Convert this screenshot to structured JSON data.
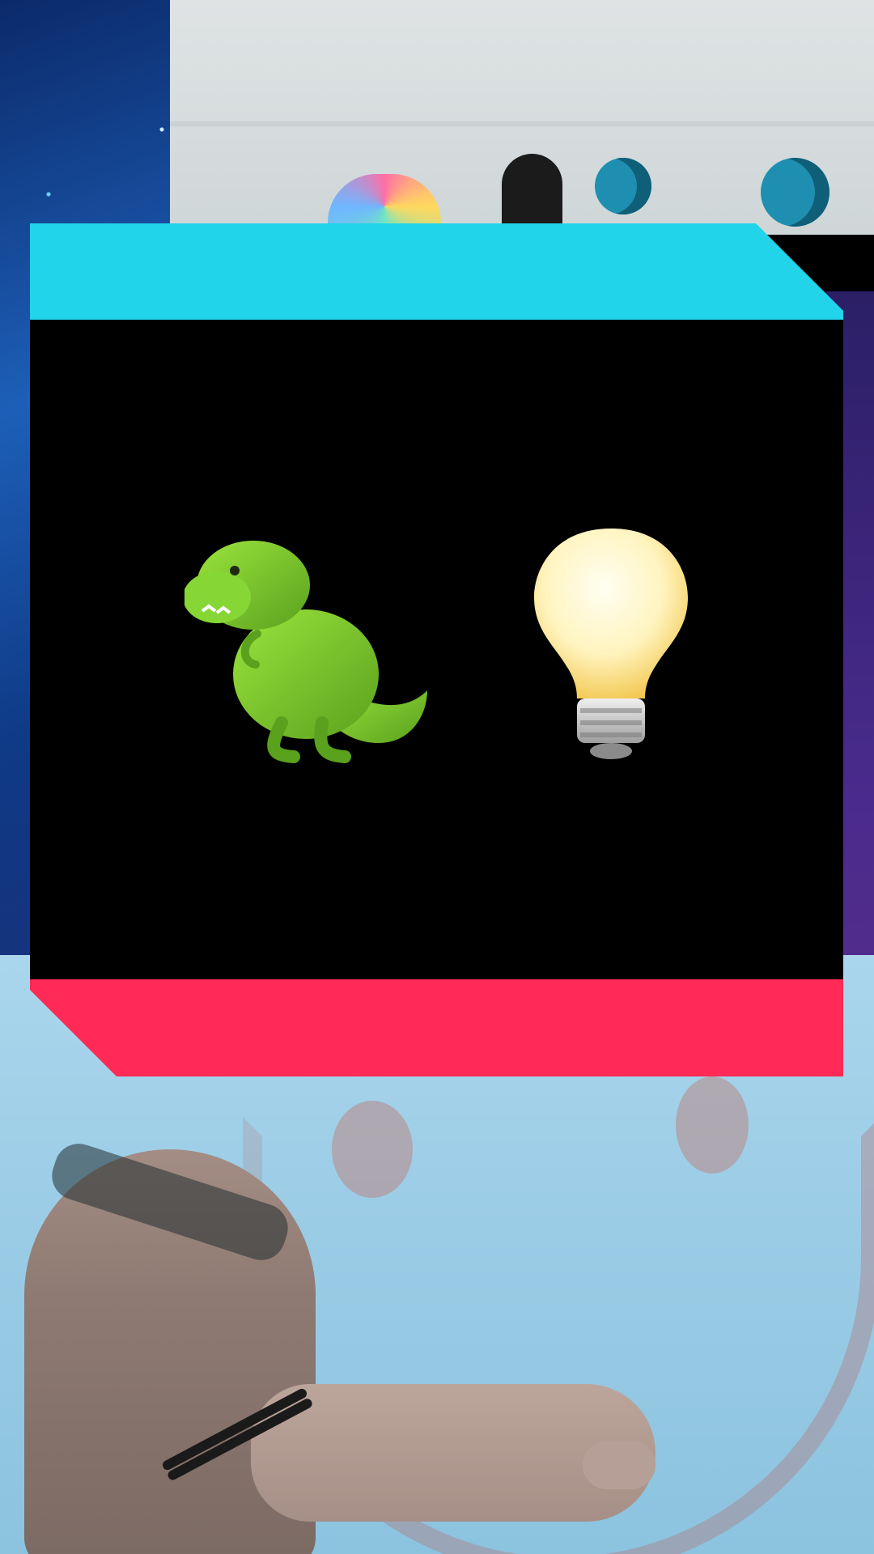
{
  "video": {
    "overlay": {
      "top_bar_color": "#21D4EA",
      "bottom_bar_color": "#FF2A55",
      "panel_color": "#000000",
      "emojis": [
        {
          "name": "t-rex",
          "glyph": "🦖"
        },
        {
          "name": "light-bulb",
          "glyph": "💡"
        }
      ]
    }
  }
}
